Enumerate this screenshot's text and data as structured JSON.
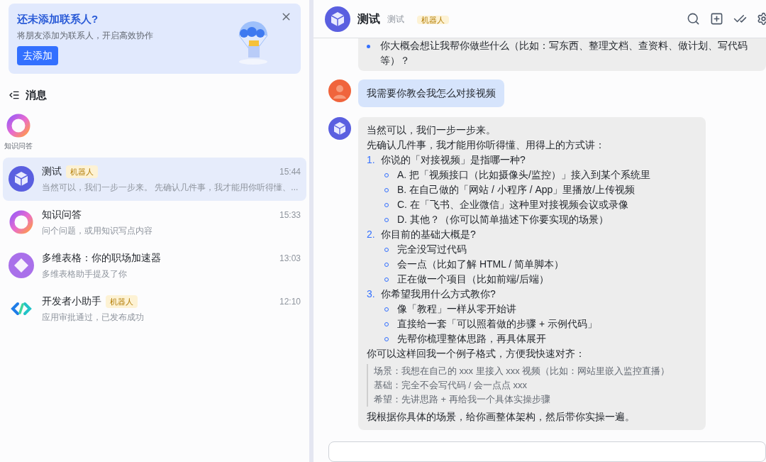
{
  "banner": {
    "title": "还未添加联系人?",
    "subtitle": "将朋友添加为联系人，开启高效协作",
    "button": "去添加"
  },
  "section": {
    "title": "消息"
  },
  "pinned": [
    {
      "name": "知识问答",
      "kind": "ring"
    }
  ],
  "conversations": [
    {
      "name": "测试",
      "badge": "机器人",
      "time": "15:44",
      "preview": "当然可以，我们一步一步来。 先确认几件事，我才能用你听得懂、...",
      "selected": true,
      "kind": "cube"
    },
    {
      "name": "知识问答",
      "time": "15:33",
      "preview": "问个问题，或用知识写点内容",
      "selected": false,
      "kind": "ring"
    },
    {
      "name": "多维表格：你的职场加速器",
      "time": "13:03",
      "preview": "多维表格助手提及了你",
      "selected": false,
      "kind": "diamond"
    },
    {
      "name": "开发者小助手",
      "badge": "机器人",
      "time": "12:10",
      "preview": "应用审批通过，已发布成功",
      "selected": false,
      "kind": "code"
    }
  ],
  "chat": {
    "title": "测试",
    "subtitle": "测试",
    "badge": "机器人",
    "messages": [
      {
        "kind": "bot_cut",
        "bullets": [
          "你大概会想让我帮你做些什么（比如：写东西、整理文档、查资料、做计划、写代码等）？"
        ]
      },
      {
        "kind": "user",
        "text": "我需要你教会我怎么对接视频"
      },
      {
        "kind": "bot",
        "intro": [
          "当然可以，我们一步一步来。",
          "先确认几件事，我才能用你听得懂、用得上的方式讲："
        ],
        "list": [
          {
            "number": "1.",
            "text": "你说的「对接视频」是指哪一种?",
            "children": [
              "A. 把「视频接口（比如摄像头/监控）」接入到某个系统里",
              "B. 在自己做的「网站 / 小程序 / App」里播放/上传视频",
              "C. 在「飞书、企业微信」这种里对接视频会议或录像",
              "D. 其他？（你可以简单描述下你要实现的场景）"
            ]
          },
          {
            "number": "2.",
            "text": "你目前的基础大概是?",
            "children": [
              "完全没写过代码",
              "会一点（比如了解 HTML / 简单脚本）",
              "正在做一个项目（比如前端/后端）"
            ]
          },
          {
            "number": "3.",
            "text": "你希望我用什么方式教你?",
            "children": [
              "像「教程」一样从零开始讲",
              "直接给一套「可以照着做的步骤 + 示例代码」",
              "先帮你梳理整体思路，再具体展开"
            ]
          }
        ],
        "lead": "你可以这样回我一个例子格式，方便我快速对齐：",
        "quote": [
          "场景：我想在自己的 xxx 里接入 xxx 视频（比如：网站里嵌入监控直播）",
          "基础：完全不会写代码 / 会一点点 xxx",
          "希望：先讲思路 + 再给我一个具体实操步骤"
        ],
        "outro": "我根据你具体的场景，给你画整体架构，然后带你实操一遍。"
      }
    ]
  }
}
